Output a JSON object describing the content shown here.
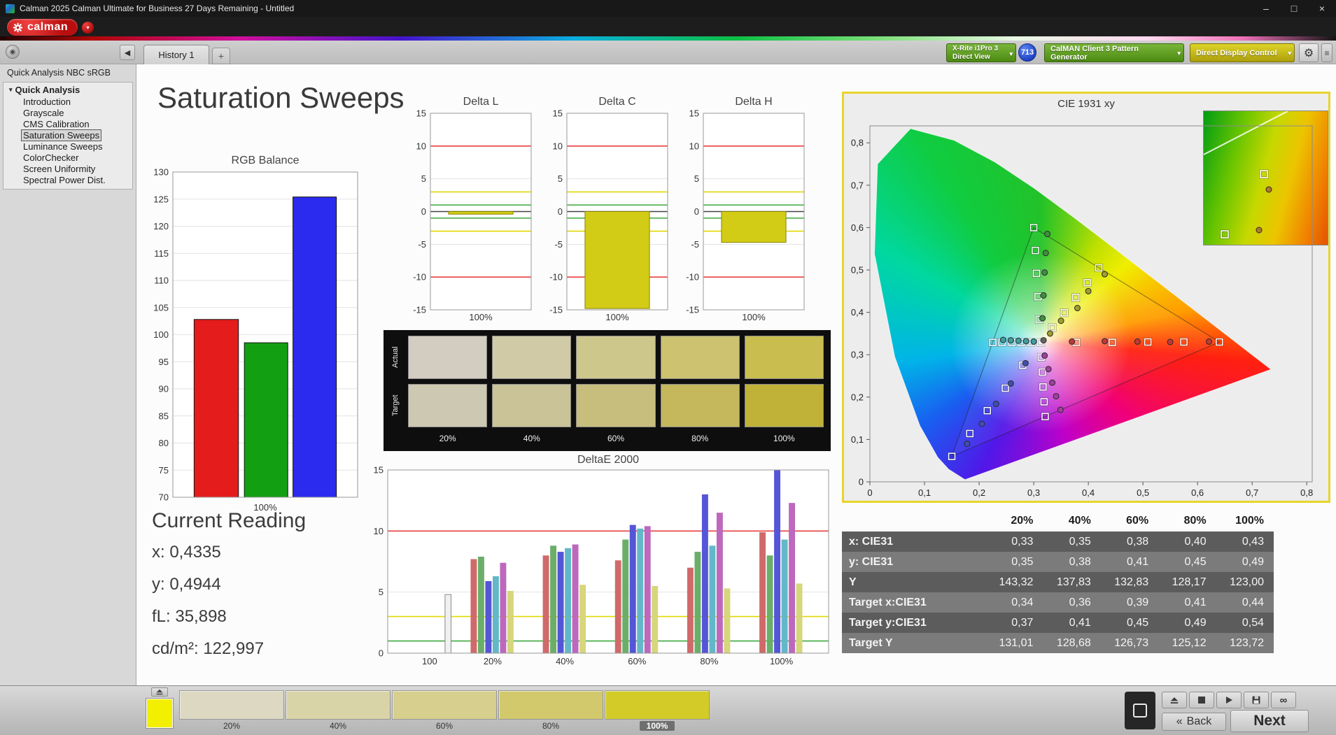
{
  "window": {
    "title": "Calman 2025 Calman Ultimate for Business 27 Days Remaining  - Untitled"
  },
  "icons": {
    "minimize": "–",
    "maximize": "□",
    "close": "×",
    "dropdown": "▾",
    "collapse": "◀",
    "add_tab": "+",
    "gear": "⚙",
    "menu": "≡",
    "infinity": "∞",
    "back_chevron": "«",
    "tree_arrow": "▾",
    "pin": "◉",
    "logo_menu": "▾"
  },
  "brand": {
    "name": "calman"
  },
  "tabs": {
    "history": "History 1"
  },
  "toolbar": {
    "meter_line1": "X-Rite i1Pro 3",
    "meter_line2": "Direct View",
    "badge": "713",
    "pattern_generator": "CalMAN Client 3 Pattern Generator",
    "display_control": "Direct Display Control"
  },
  "sidebar": {
    "header": "Quick Analysis NBC sRGB",
    "root": "Quick Analysis",
    "items": [
      "Introduction",
      "Grayscale",
      "CMS Calibration",
      "Saturation Sweeps",
      "Luminance Sweeps",
      "ColorChecker",
      "Screen Uniformity",
      "Spectral Power Dist."
    ],
    "selected_index": 3
  },
  "page": {
    "title": "Saturation Sweeps"
  },
  "current_reading": {
    "title": "Current Reading",
    "x": "x: 0,4335",
    "y": "y: 0,4944",
    "fl": "fL: 35,898",
    "cd": "cd/m²: 122,997"
  },
  "swatch_compare": {
    "row_labels": [
      "Actual",
      "Target"
    ],
    "col_labels": [
      "20%",
      "40%",
      "60%",
      "80%",
      "100%"
    ],
    "actual_colors": [
      "#d2cdc0",
      "#d0cba6",
      "#cec78c",
      "#ccc26f",
      "#c9bd4f"
    ],
    "target_colors": [
      "#cdc8b2",
      "#cac397",
      "#c7bd7c",
      "#c4b75c",
      "#c0b138"
    ]
  },
  "table": {
    "columns": [
      "20%",
      "40%",
      "60%",
      "80%",
      "100%"
    ],
    "rows": [
      {
        "label": "x: CIE31",
        "values": [
          "0,33",
          "0,35",
          "0,38",
          "0,40",
          "0,43"
        ]
      },
      {
        "label": "y: CIE31",
        "values": [
          "0,35",
          "0,38",
          "0,41",
          "0,45",
          "0,49"
        ]
      },
      {
        "label": "Y",
        "values": [
          "143,32",
          "137,83",
          "132,83",
          "128,17",
          "123,00"
        ]
      },
      {
        "label": "Target x:CIE31",
        "values": [
          "0,34",
          "0,36",
          "0,39",
          "0,41",
          "0,44"
        ]
      },
      {
        "label": "Target y:CIE31",
        "values": [
          "0,37",
          "0,41",
          "0,45",
          "0,49",
          "0,54"
        ]
      },
      {
        "label": "Target Y",
        "values": [
          "131,01",
          "128,68",
          "126,73",
          "125,12",
          "123,72"
        ]
      }
    ]
  },
  "bottom_bar": {
    "current_color": "#f2ef00",
    "levels": [
      {
        "label": "20%",
        "color": "#dcd8c2"
      },
      {
        "label": "40%",
        "color": "#d9d4a8"
      },
      {
        "label": "60%",
        "color": "#d6cf8d"
      },
      {
        "label": "80%",
        "color": "#d2c96d"
      },
      {
        "label": "100%",
        "color": "#d2cb28"
      }
    ],
    "selected": "100%",
    "back": "Back",
    "next": "Next"
  },
  "chart_data": [
    {
      "id": "rgb_balance",
      "type": "bar",
      "title": "RGB Balance",
      "categories": [
        "Red",
        "Green",
        "Blue"
      ],
      "values": [
        102.8,
        98.5,
        125.4
      ],
      "colors": [
        "#e41c1c",
        "#12a012",
        "#2b2bf0"
      ],
      "ylim": [
        70,
        130
      ],
      "ytick_step": 5,
      "xlabel": "100%"
    },
    {
      "id": "delta_l",
      "type": "bar",
      "title": "Delta L",
      "categories": [
        "100%"
      ],
      "values": [
        -0.4
      ],
      "ylim": [
        -15,
        15
      ],
      "ytick_step": 5,
      "limits": {
        "red": 10,
        "yellow": 3,
        "green": 1
      },
      "xlabel": "100%",
      "bar_color": "#d2cc16"
    },
    {
      "id": "delta_c",
      "type": "bar",
      "title": "Delta C",
      "categories": [
        "100%"
      ],
      "values": [
        -14.8
      ],
      "ylim": [
        -15,
        15
      ],
      "ytick_step": 5,
      "limits": {
        "red": 10,
        "yellow": 3,
        "green": 1
      },
      "xlabel": "100%",
      "bar_color": "#d2cc16"
    },
    {
      "id": "delta_h",
      "type": "bar",
      "title": "Delta H",
      "categories": [
        "100%"
      ],
      "values": [
        -4.7
      ],
      "ylim": [
        -15,
        15
      ],
      "ytick_step": 5,
      "limits": {
        "red": 10,
        "yellow": 3,
        "green": 1
      },
      "xlabel": "100%",
      "bar_color": "#d2cc16"
    },
    {
      "id": "deltae2000",
      "type": "grouped-bar",
      "title": "DeltaE 2000",
      "ylim": [
        0,
        15
      ],
      "ytick_step": 5,
      "limits": {
        "red": 10,
        "yellow": 3,
        "green": 1
      },
      "series": [
        "red",
        "green",
        "blue",
        "cyan",
        "magenta",
        "yellow"
      ],
      "series_colors": [
        "#d06a6a",
        "#6aae6a",
        "#5555d8",
        "#62b8c8",
        "#bd68bd",
        "#d6d67c"
      ],
      "grayscale_color": "#f0f0f0",
      "groups": [
        {
          "label": "100",
          "values": [
            4.8
          ]
        },
        {
          "label": "20%",
          "values": [
            7.7,
            7.9,
            5.9,
            6.3,
            7.4,
            5.1
          ]
        },
        {
          "label": "40%",
          "values": [
            8.0,
            8.8,
            8.3,
            8.6,
            8.9,
            5.6
          ]
        },
        {
          "label": "60%",
          "values": [
            7.6,
            9.3,
            10.5,
            10.2,
            10.4,
            5.5
          ]
        },
        {
          "label": "80%",
          "values": [
            7.0,
            8.3,
            13.0,
            8.8,
            11.5,
            5.3
          ]
        },
        {
          "label": "100%",
          "values": [
            9.9,
            8.0,
            15.0,
            9.3,
            12.3,
            5.7
          ]
        }
      ]
    },
    {
      "id": "cie",
      "type": "scatter",
      "title": "CIE 1931 xy",
      "xlim": [
        0,
        0.81
      ],
      "ylim": [
        0,
        0.84
      ],
      "x_ticks": [
        "0",
        "0,1",
        "0,2",
        "0,3",
        "0,4",
        "0,5",
        "0,6",
        "0,7",
        "0,8"
      ],
      "y_ticks": [
        "0",
        "0,1",
        "0,2",
        "0,3",
        "0,4",
        "0,5",
        "0,6",
        "0,7",
        "0,8"
      ],
      "white_point": [
        0.3127,
        0.329
      ],
      "gamut_triangle": [
        [
          0.64,
          0.33
        ],
        [
          0.3,
          0.6
        ],
        [
          0.15,
          0.06
        ]
      ],
      "targets": [
        {
          "name": "red",
          "points": [
            [
              0.378,
              0.329
            ],
            [
              0.444,
              0.329
            ],
            [
              0.509,
              0.33
            ],
            [
              0.575,
              0.33
            ],
            [
              0.64,
              0.33
            ]
          ]
        },
        {
          "name": "green",
          "points": [
            [
              0.31,
              0.383
            ],
            [
              0.308,
              0.437
            ],
            [
              0.305,
              0.492
            ],
            [
              0.303,
              0.546
            ],
            [
              0.3,
              0.6
            ]
          ]
        },
        {
          "name": "blue",
          "points": [
            [
              0.28,
              0.275
            ],
            [
              0.248,
              0.221
            ],
            [
              0.215,
              0.168
            ],
            [
              0.183,
              0.114
            ],
            [
              0.15,
              0.06
            ]
          ]
        },
        {
          "name": "cyan",
          "points": [
            [
              0.295,
              0.329
            ],
            [
              0.277,
              0.329
            ],
            [
              0.26,
              0.329
            ],
            [
              0.242,
              0.329
            ],
            [
              0.225,
              0.329
            ]
          ]
        },
        {
          "name": "magenta",
          "points": [
            [
              0.314,
              0.294
            ],
            [
              0.316,
              0.259
            ],
            [
              0.317,
              0.224
            ],
            [
              0.319,
              0.189
            ],
            [
              0.321,
              0.154
            ]
          ]
        },
        {
          "name": "yellow",
          "points": [
            [
              0.334,
              0.364
            ],
            [
              0.356,
              0.399
            ],
            [
              0.377,
              0.435
            ],
            [
              0.398,
              0.47
            ],
            [
              0.419,
              0.505
            ]
          ]
        },
        {
          "name": "white",
          "points": [
            [
              0.313,
              0.329
            ]
          ]
        }
      ],
      "measured": [
        {
          "name": "white",
          "color": "#666666",
          "points": [
            [
              0.318,
              0.334
            ]
          ]
        },
        {
          "name": "red",
          "color": "#c03838",
          "points": [
            [
              0.37,
              0.331
            ],
            [
              0.43,
              0.332
            ],
            [
              0.49,
              0.331
            ],
            [
              0.55,
              0.33
            ],
            [
              0.621,
              0.331
            ]
          ]
        },
        {
          "name": "green",
          "color": "#3f8f3f",
          "points": [
            [
              0.316,
              0.386
            ],
            [
              0.318,
              0.44
            ],
            [
              0.32,
              0.494
            ],
            [
              0.322,
              0.54
            ],
            [
              0.325,
              0.585
            ]
          ]
        },
        {
          "name": "blue",
          "color": "#3f4fb0",
          "points": [
            [
              0.285,
              0.28
            ],
            [
              0.258,
              0.232
            ],
            [
              0.231,
              0.184
            ],
            [
              0.205,
              0.137
            ],
            [
              0.178,
              0.09
            ]
          ]
        },
        {
          "name": "cyan",
          "color": "#3f9f9f",
          "points": [
            [
              0.3,
              0.331
            ],
            [
              0.286,
              0.332
            ],
            [
              0.272,
              0.333
            ],
            [
              0.258,
              0.334
            ],
            [
              0.244,
              0.335
            ]
          ]
        },
        {
          "name": "magenta",
          "color": "#a03fa0",
          "points": [
            [
              0.32,
              0.298
            ],
            [
              0.327,
              0.266
            ],
            [
              0.334,
              0.234
            ],
            [
              0.341,
              0.202
            ],
            [
              0.349,
              0.17
            ]
          ]
        },
        {
          "name": "yellow",
          "color": "#a09f30",
          "points": [
            [
              0.33,
              0.35
            ],
            [
              0.35,
              0.38
            ],
            [
              0.38,
              0.41
            ],
            [
              0.4,
              0.45
            ],
            [
              0.43,
              0.49
            ]
          ]
        }
      ]
    }
  ]
}
